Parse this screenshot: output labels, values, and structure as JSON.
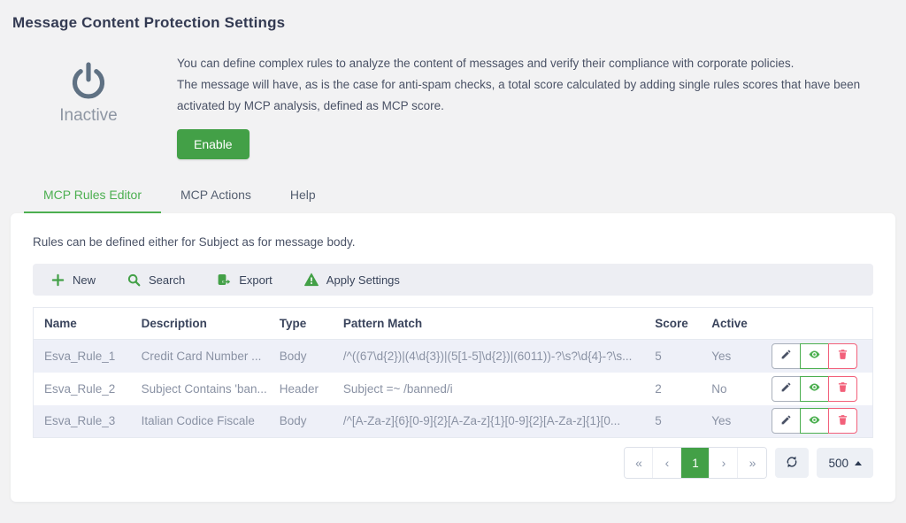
{
  "header": {
    "title": "Message Content Protection Settings"
  },
  "status": {
    "icon": "power-icon",
    "label": "Inactive"
  },
  "intro": {
    "line1": "You can define complex rules to analyze the content of messages and verify their compliance with corporate policies.",
    "line2": "The message will have, as is the case for anti-spam checks, a total score calculated by adding single rules scores that have been activated by MCP analysis, defined as MCP score.",
    "enable_label": "Enable"
  },
  "tabs": [
    {
      "label": "MCP Rules Editor",
      "active": true
    },
    {
      "label": "MCP Actions",
      "active": false
    },
    {
      "label": "Help",
      "active": false
    }
  ],
  "panel": {
    "note": "Rules can be defined either for Subject as for message body.",
    "toolbar": {
      "new_label": "New",
      "search_label": "Search",
      "export_label": "Export",
      "apply_label": "Apply Settings"
    },
    "table": {
      "columns": {
        "name": "Name",
        "description": "Description",
        "type": "Type",
        "pattern": "Pattern Match",
        "score": "Score",
        "active": "Active"
      },
      "rows": [
        {
          "name": "Esva_Rule_1",
          "description": "Credit Card Number ...",
          "type": "Body",
          "pattern": "/^((67\\d{2})|(4\\d{3})|(5[1-5]\\d{2})|(6011))-?\\s?\\d{4}-?\\s...",
          "score": "5",
          "active": "Yes"
        },
        {
          "name": "Esva_Rule_2",
          "description": "Subject Contains 'ban...",
          "type": "Header",
          "pattern": "Subject =~ /banned/i",
          "score": "2",
          "active": "No"
        },
        {
          "name": "Esva_Rule_3",
          "description": "Italian Codice Fiscale",
          "type": "Body",
          "pattern": "/^[A-Za-z]{6}[0-9]{2}[A-Za-z]{1}[0-9]{2}[A-Za-z]{1}[0...",
          "score": "5",
          "active": "Yes"
        }
      ]
    },
    "pagination": {
      "first": "«",
      "prev": "‹",
      "page": "1",
      "next": "›",
      "last": "»",
      "page_size": "500"
    }
  },
  "colors": {
    "accent_green": "#43a047",
    "tab_green": "#4caf50",
    "delete_pink": "#f2607a",
    "title_navy": "#333a52",
    "inactive_grey": "#8e96a3"
  }
}
